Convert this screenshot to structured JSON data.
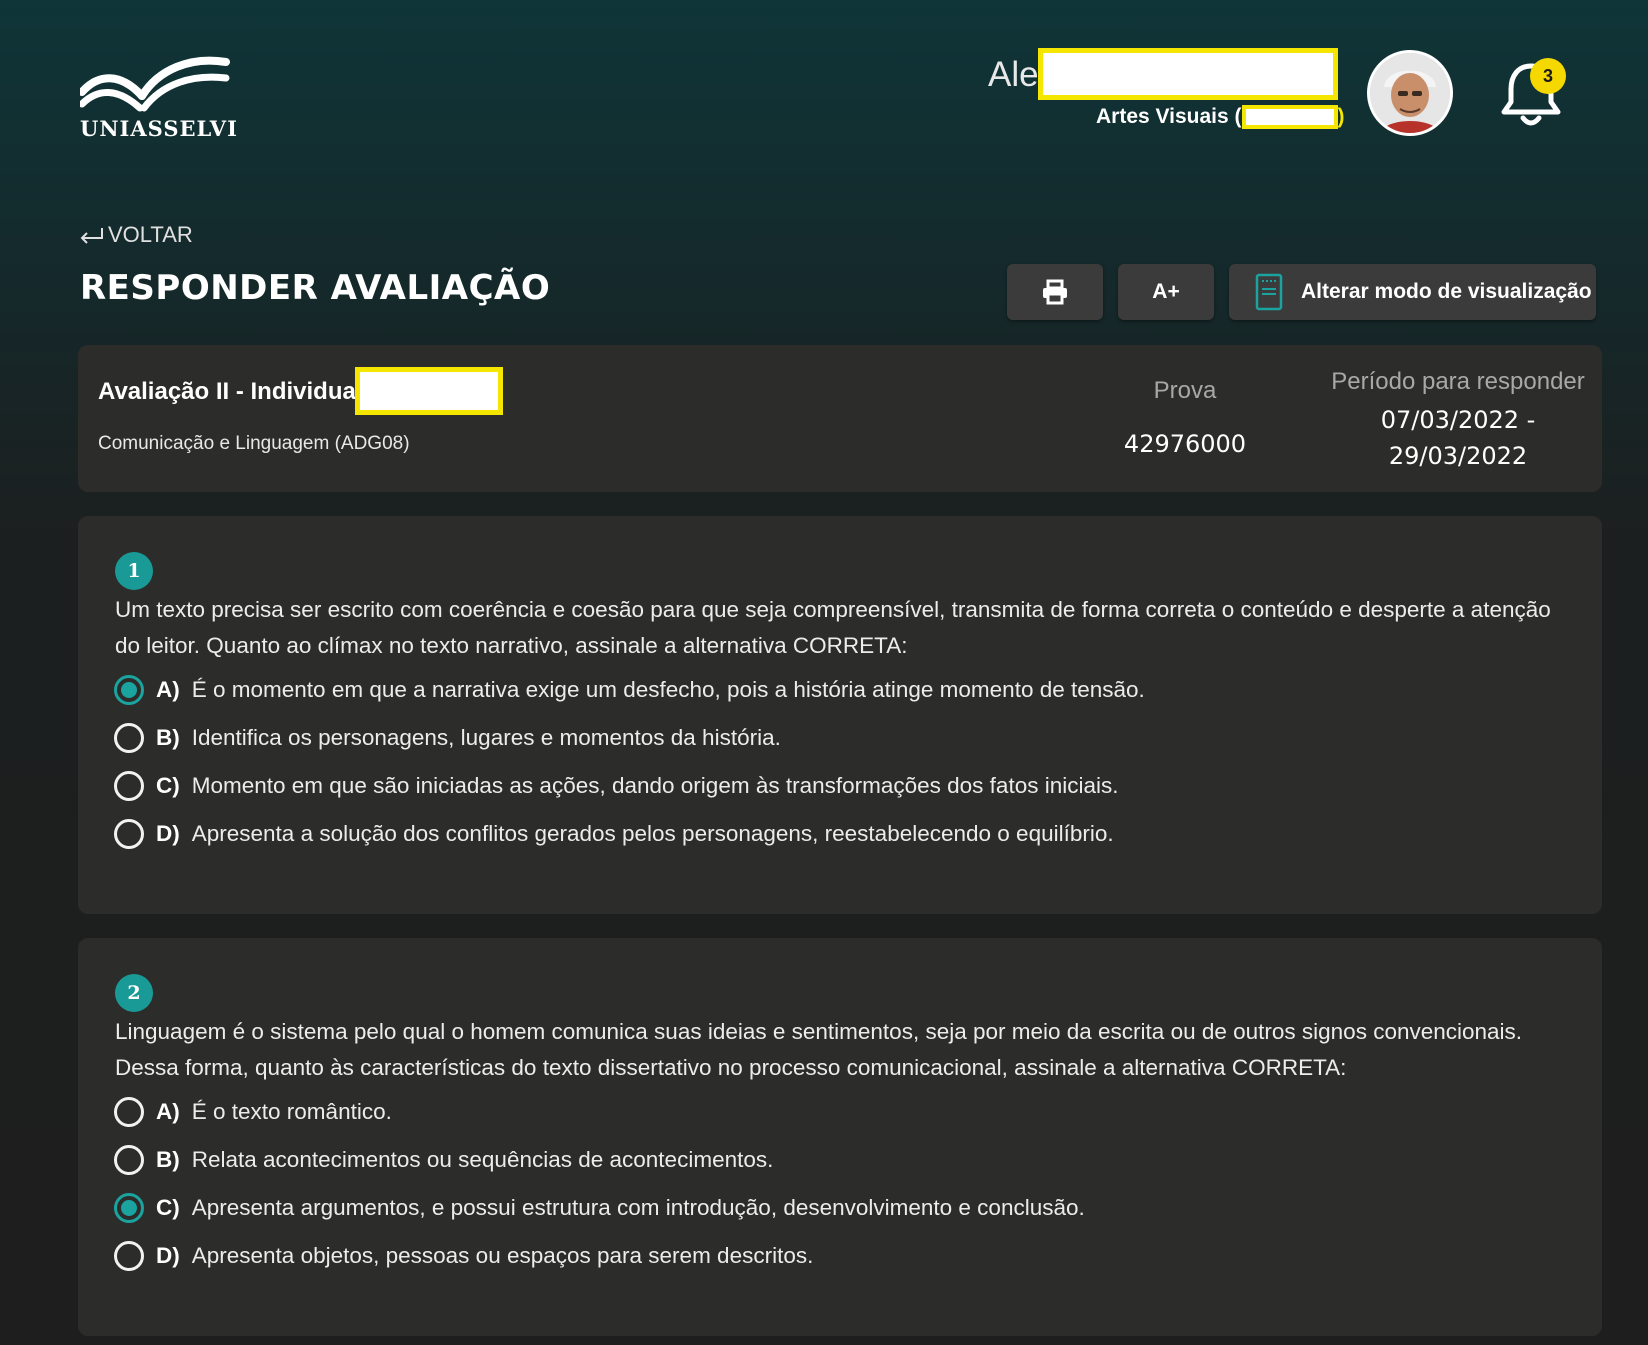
{
  "header": {
    "logo_text": "UNIASSELVI",
    "user_name": "Alex",
    "user_course_prefix": "Artes Visuais (",
    "user_course_suffix": ")",
    "notifications_count": "3"
  },
  "nav": {
    "back_label": "VOLTAR",
    "page_title": "RESPONDER AVALIAÇÃO"
  },
  "toolbar": {
    "print_icon": "printer-icon",
    "font_size_label": "A+",
    "view_mode_label": "Alterar modo de visualização",
    "view_mode_icon": "document-icon"
  },
  "exam": {
    "title": "Avaliação II - Individual (",
    "subject": "Comunicação e Linguagem (ADG08)",
    "prova_label": "Prova",
    "prova_value": "42976000",
    "period_label": "Período para responder",
    "period_start": "07/03/2022 -",
    "period_end": "29/03/2022"
  },
  "questions": [
    {
      "number": "1",
      "text": "Um texto precisa ser escrito com coerência e coesão para que seja compreensível, transmita de forma correta o conteúdo e desperte a atenção do leitor. Quanto ao clímax no texto narrativo, assinale a alternativa CORRETA:",
      "options": [
        {
          "letter": "A)",
          "text": "É o momento em que a narrativa exige um desfecho, pois a história atinge momento de tensão.",
          "selected": true
        },
        {
          "letter": "B)",
          "text": "Identifica os personagens, lugares e momentos da história.",
          "selected": false
        },
        {
          "letter": "C)",
          "text": "Momento em que são iniciadas as ações, dando origem às transformações dos fatos iniciais.",
          "selected": false
        },
        {
          "letter": "D)",
          "text": "Apresenta a solução dos conflitos gerados pelos personagens, reestabelecendo o equilíbrio.",
          "selected": false
        }
      ]
    },
    {
      "number": "2",
      "text": "Linguagem é o sistema pelo qual o homem comunica suas ideias e sentimentos, seja por meio da escrita ou de outros signos convencionais. Dessa forma, quanto às características do texto dissertativo no processo comunicacional, assinale a alternativa CORRETA:",
      "options": [
        {
          "letter": "A)",
          "text": "É o texto romântico.",
          "selected": false
        },
        {
          "letter": "B)",
          "text": "Relata acontecimentos ou sequências de acontecimentos.",
          "selected": false
        },
        {
          "letter": "C)",
          "text": "Apresenta argumentos, e possui estrutura com introdução, desenvolvimento e conclusão.",
          "selected": true
        },
        {
          "letter": "D)",
          "text": "Apresenta objetos, pessoas ou espaços para serem descritos.",
          "selected": false
        }
      ]
    }
  ],
  "colors": {
    "accent_teal": "#1aa39f",
    "badge_yellow": "#f5d800",
    "redaction_border": "#f5e600"
  }
}
